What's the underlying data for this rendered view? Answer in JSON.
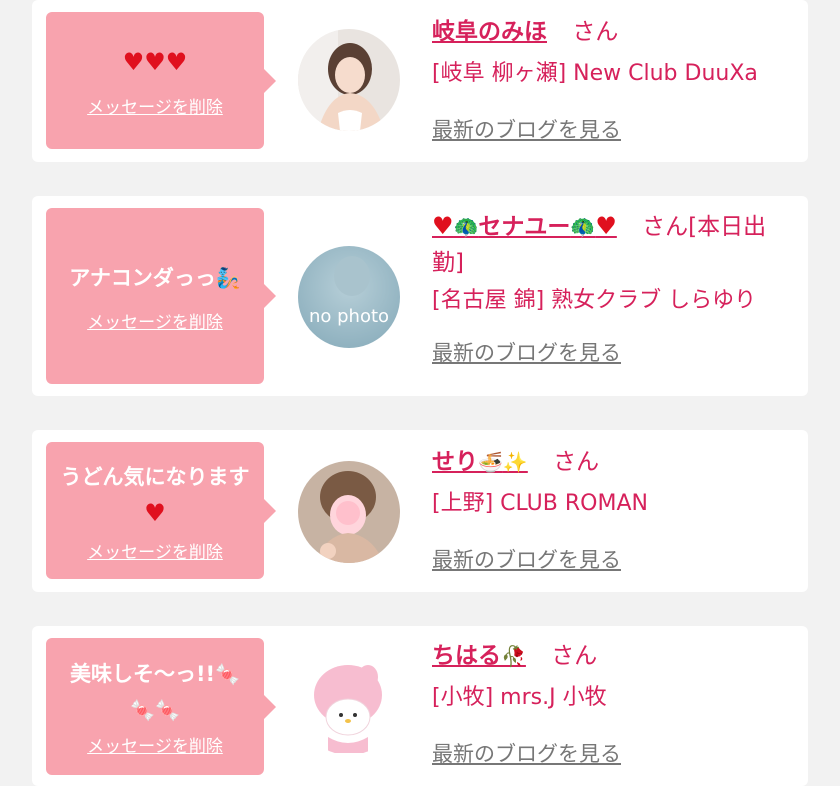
{
  "colors": {
    "accent": "#d6215b",
    "bubble": "#f8a3ae",
    "background": "#f2f2f2",
    "card": "#ffffff",
    "link_gray": "#777777"
  },
  "delete_label": "メッセージを削除",
  "blog_label": "最新のブログを見る",
  "san_label": "さん",
  "items": [
    {
      "message": "",
      "message_icons": [
        "heart-icon",
        "heart-icon",
        "heart-icon"
      ],
      "name": "岐阜のみほ",
      "suffix": "",
      "shop": "[岐阜 柳ヶ瀬] New Club DuuXa",
      "avatar": "photo-avatar"
    },
    {
      "message": "アナコンダっっ",
      "message_icons": [
        "genie-icon"
      ],
      "name": "セナユー",
      "suffix": "[本日出勤]",
      "name_icons": [
        "heart-arrow-icon",
        "peacock-icon",
        "peacock-icon",
        "heart-arrow-icon"
      ],
      "shop": "[名古屋 錦] 熟女クラブ しらゆり",
      "avatar": "no photo"
    },
    {
      "message": "うどん気になります",
      "message_icons": [
        "heart-icon"
      ],
      "name": "せり",
      "suffix": "",
      "name_icons": [
        "bowl-icon",
        "sparkles-icon"
      ],
      "shop": "[上野] CLUB ROMAN",
      "avatar": "photo-avatar"
    },
    {
      "message": "美味しそ〜っ!!",
      "message_icons": [
        "candy-icon",
        "candy-icon",
        "candy-icon"
      ],
      "name": "ちはる",
      "suffix": "",
      "name_icons": [
        "rose-icon"
      ],
      "shop": "[小牧] mrs.J 小牧",
      "avatar": "plush-avatar"
    }
  ]
}
